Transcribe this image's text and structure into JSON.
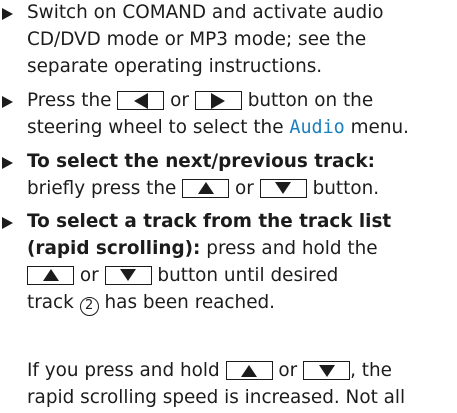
{
  "items": [
    {
      "lines": [
        "Switch on COMAND and activate audio",
        "CD/DVD mode or MP3 mode; see the",
        "separate operating instructions."
      ]
    },
    {
      "line1_prefix": "Press the",
      "line1_or": "or",
      "line1_suffix": "button on the",
      "line2_prefix": "steering wheel to select the",
      "menu_name": "Audio",
      "line2_suffix": "menu."
    },
    {
      "heading": "To select the next/previous track:",
      "line2_prefix": "briefly press the",
      "line2_or": "or",
      "line2_suffix": "button."
    },
    {
      "heading_line1": "To select a track from the track list",
      "heading_line2": "(rapid scrolling):",
      "line2_rest": "press and hold the",
      "line3_or": "or",
      "line3_suffix": "button until desired",
      "line4_prefix": "track",
      "callout": "2",
      "line4_suffix": "has been reached."
    }
  ],
  "note": {
    "line1_prefix": "If you press and hold",
    "line1_or": "or",
    "line1_suffix": ", the",
    "line2": "rapid scrolling speed is increased. Not all"
  }
}
